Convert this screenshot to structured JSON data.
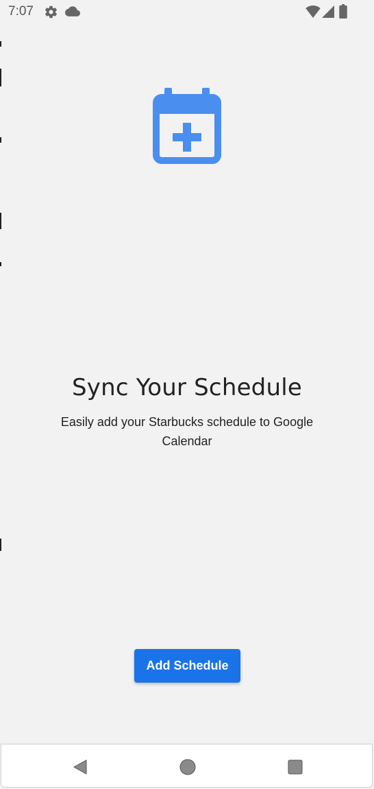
{
  "status_bar": {
    "time": "7:07",
    "left_icons": [
      "gear-icon",
      "cloud-icon"
    ],
    "right_icons": [
      "wifi-icon",
      "signal-icon",
      "battery-icon"
    ]
  },
  "main": {
    "icon": "calendar-add-icon",
    "title": "Sync Your Schedule",
    "subtitle": "Easily add your Starbucks schedule to Google Calendar",
    "add_button_label": "Add Schedule"
  },
  "nav_bar": {
    "buttons": [
      "back-icon",
      "home-icon",
      "recents-icon"
    ]
  },
  "colors": {
    "accent": "#1a73e8",
    "icon_blue": "#4a8ff0",
    "background": "#f2f2f2",
    "status_icon": "#666666",
    "nav_icon": "#8a8a8a"
  }
}
